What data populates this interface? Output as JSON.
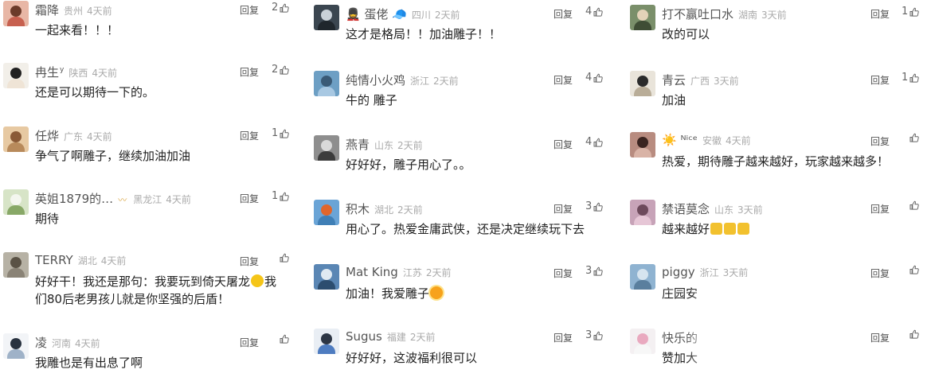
{
  "labels": {
    "reply": "回复"
  },
  "colors": {
    "meta": "#aaaaaa",
    "badge": "#d9a441"
  },
  "columns": [
    {
      "comments": [
        {
          "name": "霜降",
          "name_sup": "",
          "badge": "",
          "region": "贵州",
          "time": "4天前",
          "likes": "2",
          "text_parts": [
            "一起来看！！！"
          ],
          "avatar_bg": "#e8b7a6",
          "avatar_head": "#6b3b2a",
          "avatar_body": "#c7604f"
        },
        {
          "name": "冉生",
          "name_sup": "y",
          "badge": "",
          "region": "陕西",
          "time": "4天前",
          "likes": "2",
          "text_parts": [
            "还是可以期待一下的。"
          ],
          "avatar_bg": "#f2efe9",
          "avatar_head": "#222222",
          "avatar_body": "#efe4d6"
        },
        {
          "name": "任烨",
          "name_sup": "",
          "badge": "",
          "region": "广东",
          "time": "4天前",
          "likes": "1",
          "text_parts": [
            "争气了啊雕子，继续加油加油"
          ],
          "avatar_bg": "#e7c9a2",
          "avatar_head": "#8a5a37",
          "avatar_body": "#b88a5b"
        },
        {
          "name": "英姐1879的…",
          "name_sup": "",
          "badge": "〰",
          "region": "黑龙江",
          "time": "4天前",
          "likes": "1",
          "text_parts": [
            "期待"
          ],
          "avatar_bg": "#d7e4c7",
          "avatar_head": "#f4f6ef",
          "avatar_body": "#88a867"
        },
        {
          "name": "TERRY",
          "name_sup": "",
          "badge": "",
          "region": "湖北",
          "time": "4天前",
          "likes": "",
          "text_parts": [
            "好好干！我还是那句：我要玩到倚天屠龙",
            "grin",
            "我",
            "们80后老男孩儿就是你坚强的后盾！"
          ],
          "avatar_bg": "#b7b2a5",
          "avatar_head": "#5a5245",
          "avatar_body": "#8a8376"
        },
        {
          "name": "凌",
          "name_sup": "",
          "badge": "",
          "region": "河南",
          "time": "4天前",
          "likes": "",
          "text_parts": [
            "我雕也是有出息了啊"
          ],
          "avatar_bg": "#f2f4f7",
          "avatar_head": "#2a3340",
          "avatar_body": "#9fb2c8"
        }
      ]
    },
    {
      "comments": [
        {
          "name": "💂 蛋佬 🧢",
          "name_sup": "",
          "badge": "",
          "region": "四川",
          "time": "2天前",
          "likes": "4",
          "text_parts": [
            "这才是格局！！加油雕子！！"
          ],
          "avatar_bg": "#3b4650",
          "avatar_head": "#c9d1d8",
          "avatar_body": "#1f262c"
        },
        {
          "name": "纯情小火鸡",
          "name_sup": "",
          "badge": "",
          "region": "浙江",
          "time": "2天前",
          "likes": "4",
          "text_parts": [
            "牛的 雕子"
          ],
          "avatar_bg": "#6d9fc4",
          "avatar_head": "#3a5a76",
          "avatar_body": "#a8c8e2"
        },
        {
          "name": "燕青",
          "name_sup": "",
          "badge": "",
          "region": "山东",
          "time": "2天前",
          "likes": "4",
          "text_parts": [
            "好好好，雕子用心了。。"
          ],
          "avatar_bg": "#8e8e8e",
          "avatar_head": "#d9d9d9",
          "avatar_body": "#3c3c3c"
        },
        {
          "name": "积木",
          "name_sup": "",
          "badge": "",
          "region": "湖北",
          "time": "2天前",
          "likes": "3",
          "text_parts": [
            "用心了。热爱金庸武侠，还是决定继续玩下去"
          ],
          "avatar_bg": "#6aa4d6",
          "avatar_head": "#e0662b",
          "avatar_body": "#3f7fb6"
        },
        {
          "name": "Mat King",
          "name_sup": "",
          "badge": "",
          "region": "江苏",
          "time": "2天前",
          "likes": "3",
          "text_parts": [
            "加油！我爱雕子",
            "sun"
          ],
          "avatar_bg": "#5a86b4",
          "avatar_head": "#dfe9f2",
          "avatar_body": "#2c4d6f"
        },
        {
          "name": "Sugus",
          "name_sup": "",
          "badge": "",
          "region": "福建",
          "time": "2天前",
          "likes": "3",
          "text_parts": [
            "好好好，这波福利很可以"
          ],
          "avatar_bg": "#e9eef4",
          "avatar_head": "#2d3645",
          "avatar_body": "#4e7cc0"
        }
      ]
    },
    {
      "comments": [
        {
          "name": "打不赢吐口水",
          "name_sup": "",
          "badge": "",
          "region": "湖南",
          "time": "3天前",
          "likes": "1",
          "text_parts": [
            "改的可以"
          ],
          "avatar_bg": "#7a8f6a",
          "avatar_head": "#e3d2b8",
          "avatar_body": "#3f4d35"
        },
        {
          "name": "青云",
          "name_sup": "",
          "badge": "",
          "region": "广西",
          "time": "3天前",
          "likes": "1",
          "text_parts": [
            "加油"
          ],
          "avatar_bg": "#e9e4da",
          "avatar_head": "#2b2b2b",
          "avatar_body": "#b9ad98"
        },
        {
          "name": "☀️ ᴺⁱᶜᵉ",
          "name_sup": "",
          "badge": "",
          "region": "安徽",
          "time": "4天前",
          "likes": "",
          "text_parts": [
            "热爱，期待雕子越来越好，玩家越来越多！"
          ],
          "avatar_bg": "#b88c80",
          "avatar_head": "#3a2420",
          "avatar_body": "#d9b3a6"
        },
        {
          "name": "禁语莫念",
          "name_sup": "",
          "badge": "",
          "region": "山东",
          "time": "3天前",
          "likes": "",
          "text_parts": [
            "越来越好",
            "thumb-y",
            "thumb-y",
            "thumb-y"
          ],
          "avatar_bg": "#c7a3b8",
          "avatar_head": "#6d4a5c",
          "avatar_body": "#e6c6d6"
        },
        {
          "name": "piggy",
          "name_sup": "",
          "badge": "",
          "region": "浙江",
          "time": "3天前",
          "likes": "",
          "text_parts": [
            "庄园安"
          ],
          "avatar_bg": "#8fb3d1",
          "avatar_head": "#d6e4ef",
          "avatar_body": "#5a7f9e"
        },
        {
          "name": "快乐的",
          "name_sup": "",
          "badge": "",
          "region": "",
          "time": "",
          "likes": "",
          "text_parts": [
            "赞加大"
          ],
          "avatar_bg": "#f4f0f2",
          "avatar_head": "#e9a9bf",
          "avatar_body": "#f7f7f7"
        }
      ]
    }
  ]
}
